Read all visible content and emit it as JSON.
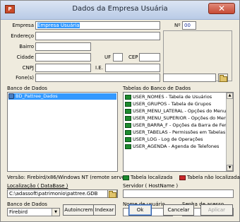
{
  "window": {
    "title": "Dados da Empresa Usuária",
    "close_symbol": "✕",
    "app_icon_letter": "P"
  },
  "form": {
    "empresa_label": "Empresa",
    "empresa_value": "Empresa Usuária",
    "numero_label": "Nº",
    "numero_value": "00",
    "endereco_label": "Endereço",
    "bairro_label": "Bairro",
    "cidade_label": "Cidade",
    "uf_label": "UF",
    "cep_label": "CEP",
    "cnpj_label": "CNPJ",
    "ie_label": "I.E.",
    "fones_label": "Fone(s)"
  },
  "database": {
    "banco_label": "Banco de Dados",
    "items": [
      "BD_Pattree_Dados"
    ],
    "tabelas_label": "Tabelas do Banco de Dados",
    "tables": [
      "USER_NOMES - Tabela de Usuários",
      "USER_GRUPOS - Tabela de Grupos",
      "USER_MENU_LATERAL - Opções do Menu",
      "USER_MENU_SUPERIOR - Opções do Men",
      "USER_BARRA_F - Opções da Barra de Ferra",
      "USER_TABELAS - Permissões em Tabelas",
      "USER_LOG - Log de Operações",
      "USER_AGENDA - Agenda de Telefones"
    ],
    "version_text": "Versão: Firebird/x86/Windows NT (remote server), ver",
    "legend_found": "Tabela localizada",
    "legend_not_found": "Tabela não localizada"
  },
  "connection": {
    "localizacao_label": "Localização ( DataBase )",
    "localizacao_value": "C:\\adassoft\\patrimonio\\pattree.GDB",
    "servidor_label": "Servidor ( HostName )",
    "servidor_value": "",
    "banco_label": "Banco de Dados",
    "banco_value": "Firebird",
    "usuario_label": "Nome de usuário",
    "senha_label": "Senha de acesso"
  },
  "buttons": {
    "autoincrem": "Autoincrem.",
    "indexar": "Indexar",
    "ok": "Ok",
    "cancelar": "Cancelar",
    "aplicar": "Aplicar"
  }
}
